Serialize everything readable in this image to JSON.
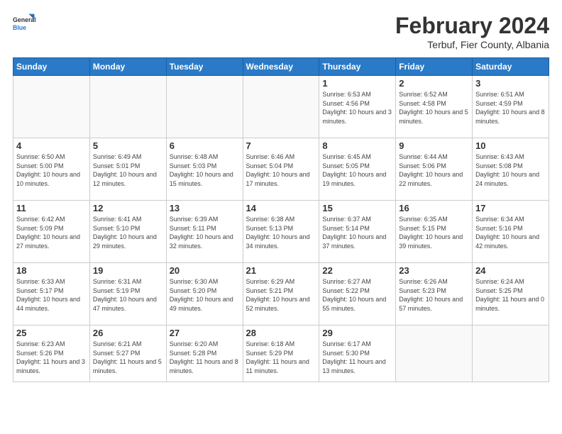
{
  "header": {
    "logo_line1": "General",
    "logo_line2": "Blue",
    "title": "February 2024",
    "location": "Terbuf, Fier County, Albania"
  },
  "weekdays": [
    "Sunday",
    "Monday",
    "Tuesday",
    "Wednesday",
    "Thursday",
    "Friday",
    "Saturday"
  ],
  "weeks": [
    [
      {
        "day": "",
        "info": ""
      },
      {
        "day": "",
        "info": ""
      },
      {
        "day": "",
        "info": ""
      },
      {
        "day": "",
        "info": ""
      },
      {
        "day": "1",
        "info": "Sunrise: 6:53 AM\nSunset: 4:56 PM\nDaylight: 10 hours\nand 3 minutes."
      },
      {
        "day": "2",
        "info": "Sunrise: 6:52 AM\nSunset: 4:58 PM\nDaylight: 10 hours\nand 5 minutes."
      },
      {
        "day": "3",
        "info": "Sunrise: 6:51 AM\nSunset: 4:59 PM\nDaylight: 10 hours\nand 8 minutes."
      }
    ],
    [
      {
        "day": "4",
        "info": "Sunrise: 6:50 AM\nSunset: 5:00 PM\nDaylight: 10 hours\nand 10 minutes."
      },
      {
        "day": "5",
        "info": "Sunrise: 6:49 AM\nSunset: 5:01 PM\nDaylight: 10 hours\nand 12 minutes."
      },
      {
        "day": "6",
        "info": "Sunrise: 6:48 AM\nSunset: 5:03 PM\nDaylight: 10 hours\nand 15 minutes."
      },
      {
        "day": "7",
        "info": "Sunrise: 6:46 AM\nSunset: 5:04 PM\nDaylight: 10 hours\nand 17 minutes."
      },
      {
        "day": "8",
        "info": "Sunrise: 6:45 AM\nSunset: 5:05 PM\nDaylight: 10 hours\nand 19 minutes."
      },
      {
        "day": "9",
        "info": "Sunrise: 6:44 AM\nSunset: 5:06 PM\nDaylight: 10 hours\nand 22 minutes."
      },
      {
        "day": "10",
        "info": "Sunrise: 6:43 AM\nSunset: 5:08 PM\nDaylight: 10 hours\nand 24 minutes."
      }
    ],
    [
      {
        "day": "11",
        "info": "Sunrise: 6:42 AM\nSunset: 5:09 PM\nDaylight: 10 hours\nand 27 minutes."
      },
      {
        "day": "12",
        "info": "Sunrise: 6:41 AM\nSunset: 5:10 PM\nDaylight: 10 hours\nand 29 minutes."
      },
      {
        "day": "13",
        "info": "Sunrise: 6:39 AM\nSunset: 5:11 PM\nDaylight: 10 hours\nand 32 minutes."
      },
      {
        "day": "14",
        "info": "Sunrise: 6:38 AM\nSunset: 5:13 PM\nDaylight: 10 hours\nand 34 minutes."
      },
      {
        "day": "15",
        "info": "Sunrise: 6:37 AM\nSunset: 5:14 PM\nDaylight: 10 hours\nand 37 minutes."
      },
      {
        "day": "16",
        "info": "Sunrise: 6:35 AM\nSunset: 5:15 PM\nDaylight: 10 hours\nand 39 minutes."
      },
      {
        "day": "17",
        "info": "Sunrise: 6:34 AM\nSunset: 5:16 PM\nDaylight: 10 hours\nand 42 minutes."
      }
    ],
    [
      {
        "day": "18",
        "info": "Sunrise: 6:33 AM\nSunset: 5:17 PM\nDaylight: 10 hours\nand 44 minutes."
      },
      {
        "day": "19",
        "info": "Sunrise: 6:31 AM\nSunset: 5:19 PM\nDaylight: 10 hours\nand 47 minutes."
      },
      {
        "day": "20",
        "info": "Sunrise: 6:30 AM\nSunset: 5:20 PM\nDaylight: 10 hours\nand 49 minutes."
      },
      {
        "day": "21",
        "info": "Sunrise: 6:29 AM\nSunset: 5:21 PM\nDaylight: 10 hours\nand 52 minutes."
      },
      {
        "day": "22",
        "info": "Sunrise: 6:27 AM\nSunset: 5:22 PM\nDaylight: 10 hours\nand 55 minutes."
      },
      {
        "day": "23",
        "info": "Sunrise: 6:26 AM\nSunset: 5:23 PM\nDaylight: 10 hours\nand 57 minutes."
      },
      {
        "day": "24",
        "info": "Sunrise: 6:24 AM\nSunset: 5:25 PM\nDaylight: 11 hours\nand 0 minutes."
      }
    ],
    [
      {
        "day": "25",
        "info": "Sunrise: 6:23 AM\nSunset: 5:26 PM\nDaylight: 11 hours\nand 3 minutes."
      },
      {
        "day": "26",
        "info": "Sunrise: 6:21 AM\nSunset: 5:27 PM\nDaylight: 11 hours\nand 5 minutes."
      },
      {
        "day": "27",
        "info": "Sunrise: 6:20 AM\nSunset: 5:28 PM\nDaylight: 11 hours\nand 8 minutes."
      },
      {
        "day": "28",
        "info": "Sunrise: 6:18 AM\nSunset: 5:29 PM\nDaylight: 11 hours\nand 11 minutes."
      },
      {
        "day": "29",
        "info": "Sunrise: 6:17 AM\nSunset: 5:30 PM\nDaylight: 11 hours\nand 13 minutes."
      },
      {
        "day": "",
        "info": ""
      },
      {
        "day": "",
        "info": ""
      }
    ]
  ]
}
